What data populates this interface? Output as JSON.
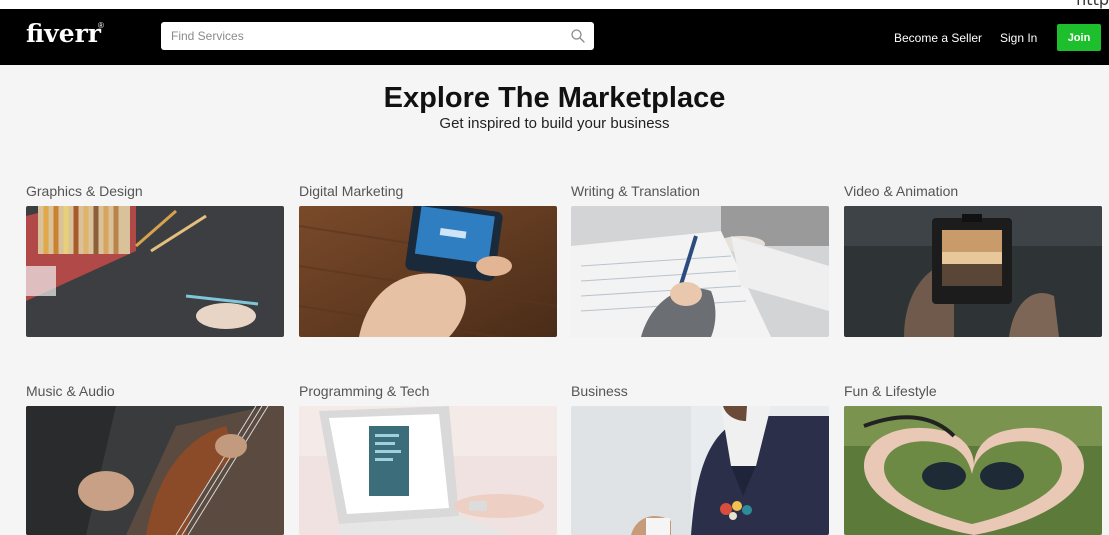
{
  "corner_text": "http",
  "header": {
    "logo": "fiverr",
    "logo_mark": "®",
    "search": {
      "placeholder": "Find Services",
      "value": ""
    },
    "become_seller": "Become a Seller",
    "sign_in": "Sign In",
    "join": "Join"
  },
  "hero": {
    "title": "Explore The Marketplace",
    "subtitle": "Get inspired to build your business"
  },
  "categories": [
    {
      "title": "Graphics & Design"
    },
    {
      "title": "Digital Marketing"
    },
    {
      "title": "Writing & Translation"
    },
    {
      "title": "Video & Animation"
    },
    {
      "title": "Music & Audio"
    },
    {
      "title": "Programming & Tech"
    },
    {
      "title": "Business"
    },
    {
      "title": "Fun & Lifestyle"
    }
  ],
  "colors": {
    "header_bg": "#000000",
    "join_green": "#1dbf2c",
    "page_bg": "#f5f5f5"
  }
}
